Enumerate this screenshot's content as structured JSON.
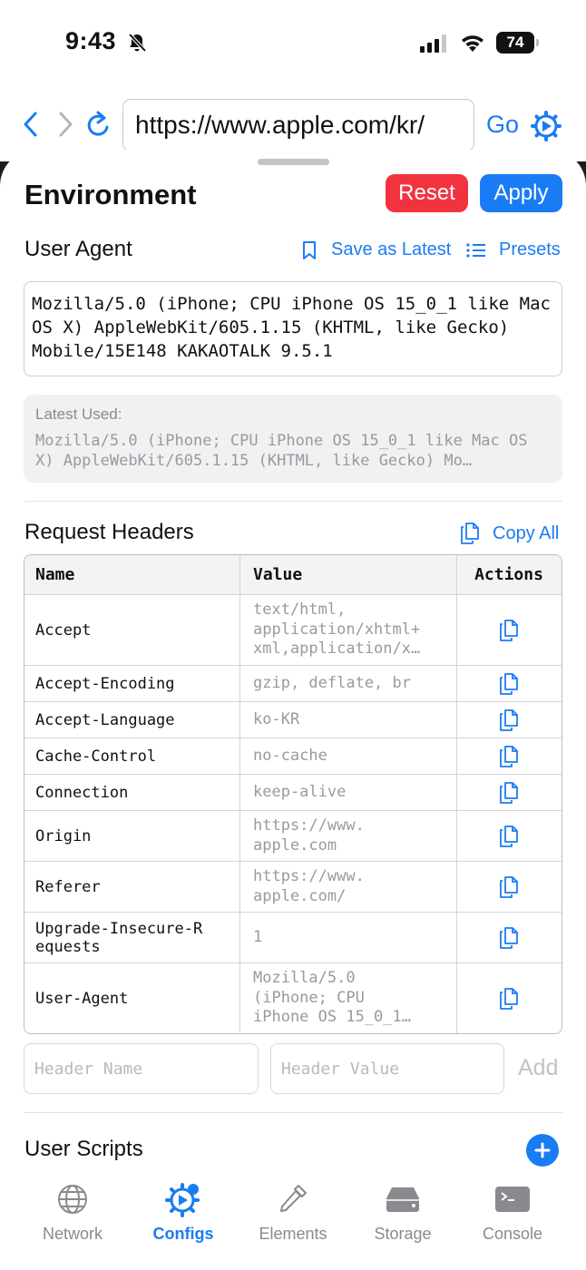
{
  "status_bar": {
    "time": "9:43",
    "battery": "74"
  },
  "browser": {
    "url": "https://www.apple.com/kr/",
    "go_label": "Go"
  },
  "header": {
    "title": "Environment",
    "reset_label": "Reset",
    "apply_label": "Apply"
  },
  "user_agent": {
    "section_title": "User Agent",
    "save_latest_label": "Save as Latest",
    "presets_label": "Presets",
    "value": "Mozilla/5.0 (iPhone; CPU iPhone OS 15_0_1 like Mac OS X) AppleWebKit/605.1.15 (KHTML, like Gecko) Mobile/15E148 KAKAOTALK 9.5.1",
    "latest_label": "Latest Used:",
    "latest_value": "Mozilla/5.0 (iPhone; CPU iPhone OS 15_0_1 like Mac OS X) AppleWebKit/605.1.15 (KHTML, like Gecko) Mo…"
  },
  "request_headers": {
    "section_title": "Request Headers",
    "copy_all_label": "Copy All",
    "columns": [
      "Name",
      "Value",
      "Actions"
    ],
    "rows": [
      {
        "name": "Accept",
        "value": "text/html,\napplication/xhtml+\nxml,application/x…"
      },
      {
        "name": "Accept-Encoding",
        "value": "gzip, deflate, br"
      },
      {
        "name": "Accept-Language",
        "value": "ko-KR"
      },
      {
        "name": "Cache-Control",
        "value": "no-cache"
      },
      {
        "name": "Connection",
        "value": "keep-alive"
      },
      {
        "name": "Origin",
        "value": "https://www.\napple.com"
      },
      {
        "name": "Referer",
        "value": "https://www.\napple.com/"
      },
      {
        "name": "Upgrade-Insecure-R\nequests",
        "value": "1"
      },
      {
        "name": "User-Agent",
        "value": "Mozilla/5.0\n(iPhone; CPU\niPhone OS 15_0_1…"
      }
    ],
    "name_placeholder": "Header Name",
    "value_placeholder": "Header Value",
    "add_label": "Add"
  },
  "user_scripts": {
    "section_title": "User Scripts"
  },
  "tabs": [
    {
      "label": "Network",
      "icon": "globe-icon"
    },
    {
      "label": "Configs",
      "icon": "gear-icon",
      "active": true
    },
    {
      "label": "Elements",
      "icon": "eyedropper-icon"
    },
    {
      "label": "Storage",
      "icon": "drive-icon"
    },
    {
      "label": "Console",
      "icon": "terminal-icon"
    }
  ],
  "colors": {
    "accent": "#1a7cf4",
    "reset": "#f2333f"
  }
}
